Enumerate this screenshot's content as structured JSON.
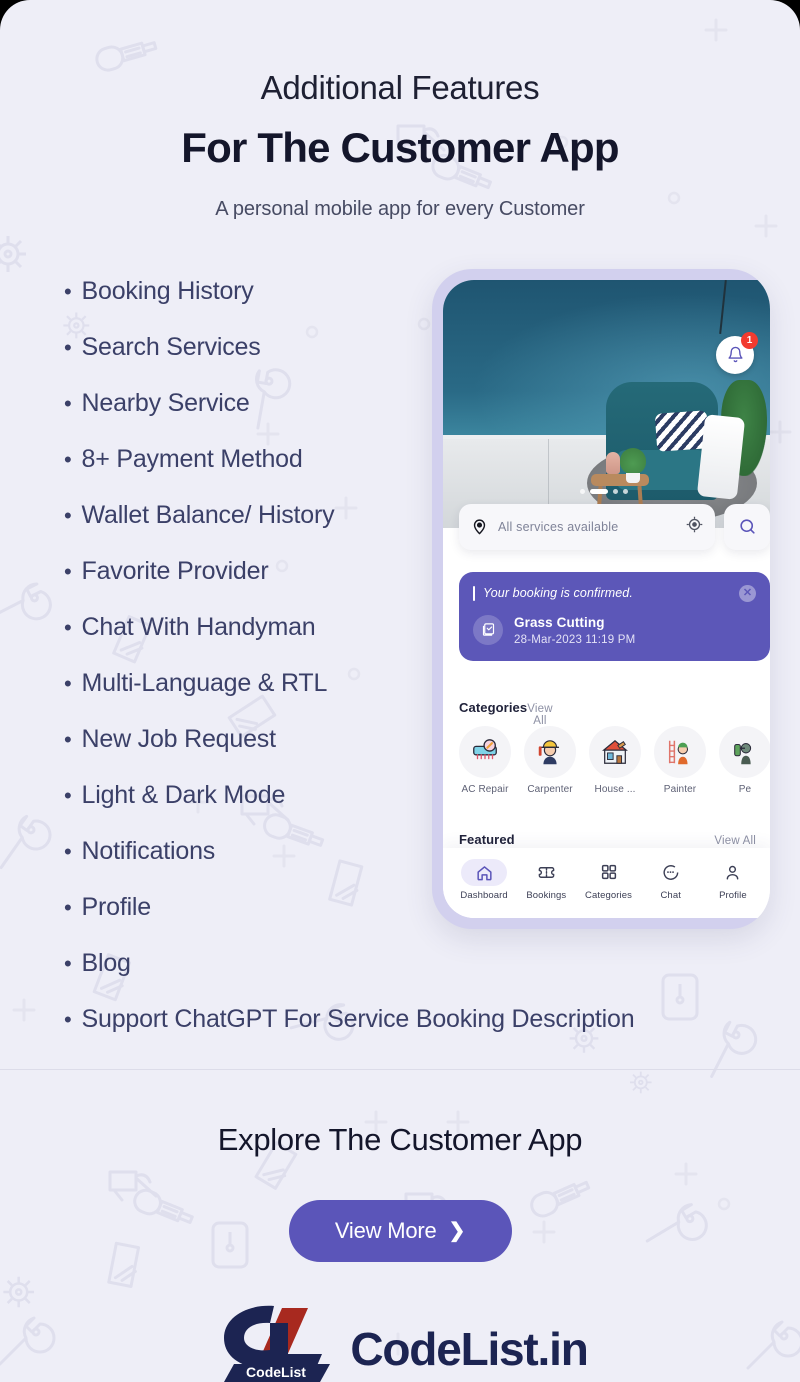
{
  "header": {
    "eyebrow": "Additional Features",
    "headline": "For The Customer App",
    "subhead": "A personal mobile app for every Customer"
  },
  "features": {
    "bullet": "•",
    "items": [
      "Booking History",
      "Search Services",
      "Nearby  Service",
      "8+ Payment Method",
      "Wallet Balance/ History",
      "Favorite Provider",
      "Chat With Handyman",
      "Multi-Language & RTL",
      "New Job Request",
      "Light & Dark Mode",
      "Notifications",
      "Profile",
      "Blog",
      "Support ChatGPT For Service Booking Description"
    ]
  },
  "phone": {
    "notification": {
      "badge": "1",
      "icon": "bell-icon"
    },
    "search": {
      "location_text": "All services available",
      "location_icon": "location-pin-icon",
      "gps_icon": "gps-target-icon",
      "search_icon": "search-icon"
    },
    "booking_banner": {
      "message": "Your booking is confirmed.",
      "service": "Grass Cutting",
      "datetime": "28-Mar-2023 11:19 PM",
      "close_icon": "close-icon",
      "service_icon": "booking-checklist-icon",
      "color": "#5c57b8"
    },
    "categories_section": {
      "title": "Categories",
      "view_all": "View All",
      "items": [
        {
          "label": "AC Repair",
          "glyph": "❄"
        },
        {
          "label": "Carpenter",
          "glyph": "👷"
        },
        {
          "label": "House ...",
          "glyph": "🏠"
        },
        {
          "label": "Painter",
          "glyph": "🧑‍🎨"
        },
        {
          "label": "Pe",
          "glyph": "🐛"
        }
      ]
    },
    "featured_section": {
      "title": "Featured",
      "view_all": "View All"
    },
    "tabs": [
      {
        "label": "Dashboard",
        "icon": "home-icon",
        "active": true
      },
      {
        "label": "Bookings",
        "icon": "ticket-icon",
        "active": false
      },
      {
        "label": "Categories",
        "icon": "grid-icon",
        "active": false
      },
      {
        "label": "Chat",
        "icon": "chat-bubble-icon",
        "active": false
      },
      {
        "label": "Profile",
        "icon": "person-icon",
        "active": false
      }
    ]
  },
  "cta": {
    "title": "Explore The Customer App",
    "button_label": "View More",
    "button_chevron": "❯",
    "button_color": "#5b55b9"
  },
  "logo": {
    "monogram_badge": "CodeList",
    "wordmark": "CodeList.in",
    "navy": "#1c2452",
    "red": "#a8291f"
  },
  "theme": {
    "background": "#eeeef7",
    "heading_color": "#14162b",
    "list_text_color": "#3b4068",
    "accent": "#5b55b9"
  }
}
